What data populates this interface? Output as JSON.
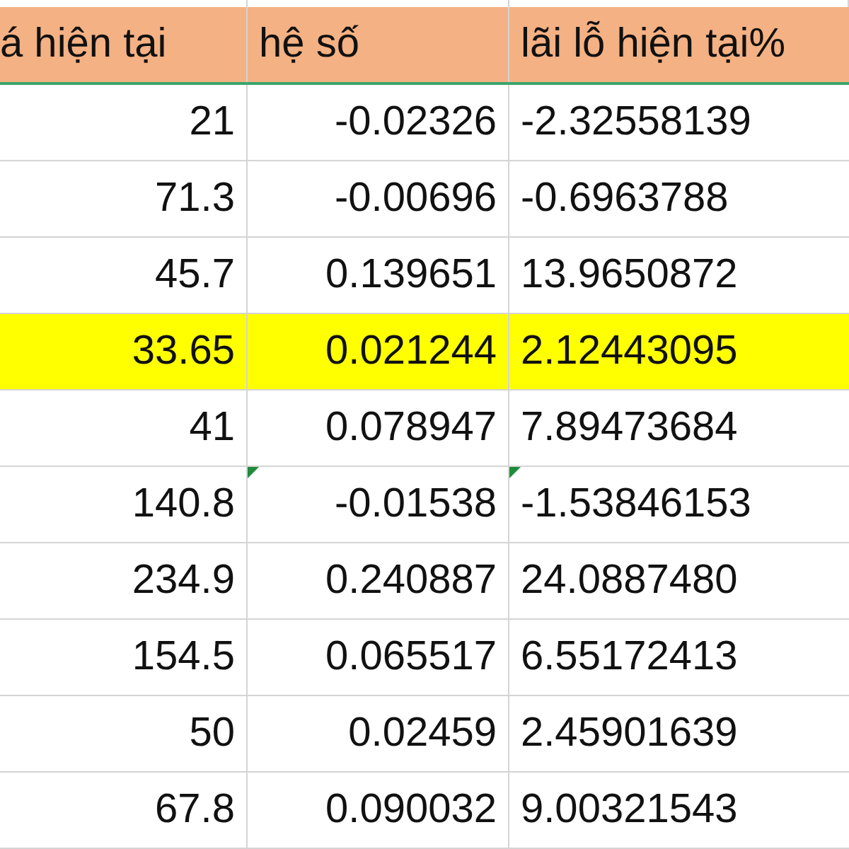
{
  "table": {
    "columns": [
      "á hiện tại",
      "hệ số",
      "lãi lỗ hiện tại%"
    ],
    "rows": [
      {
        "cells": [
          "21",
          "-0.02326",
          "-2.32558139"
        ],
        "highlighted": false,
        "flagged": [
          false,
          false,
          false
        ]
      },
      {
        "cells": [
          "71.3",
          "-0.00696",
          "-0.6963788"
        ],
        "highlighted": false,
        "flagged": [
          false,
          false,
          false
        ]
      },
      {
        "cells": [
          "45.7",
          "0.139651",
          "13.9650872"
        ],
        "highlighted": false,
        "flagged": [
          false,
          false,
          false
        ]
      },
      {
        "cells": [
          "33.65",
          "0.021244",
          "2.12443095"
        ],
        "highlighted": true,
        "flagged": [
          false,
          false,
          false
        ]
      },
      {
        "cells": [
          "41",
          "0.078947",
          "7.89473684"
        ],
        "highlighted": false,
        "flagged": [
          false,
          false,
          false
        ]
      },
      {
        "cells": [
          "140.8",
          "-0.01538",
          "-1.53846153"
        ],
        "highlighted": false,
        "flagged": [
          false,
          true,
          true
        ]
      },
      {
        "cells": [
          "234.9",
          "0.240887",
          "24.0887480"
        ],
        "highlighted": false,
        "flagged": [
          false,
          false,
          false
        ]
      },
      {
        "cells": [
          "154.5",
          "0.065517",
          "6.55172413"
        ],
        "highlighted": false,
        "flagged": [
          false,
          false,
          false
        ]
      },
      {
        "cells": [
          "50",
          "0.02459",
          "2.45901639"
        ],
        "highlighted": false,
        "flagged": [
          false,
          false,
          false
        ]
      },
      {
        "cells": [
          "67.8",
          "0.090032",
          "9.00321543"
        ],
        "highlighted": false,
        "flagged": [
          false,
          false,
          false
        ]
      }
    ]
  }
}
